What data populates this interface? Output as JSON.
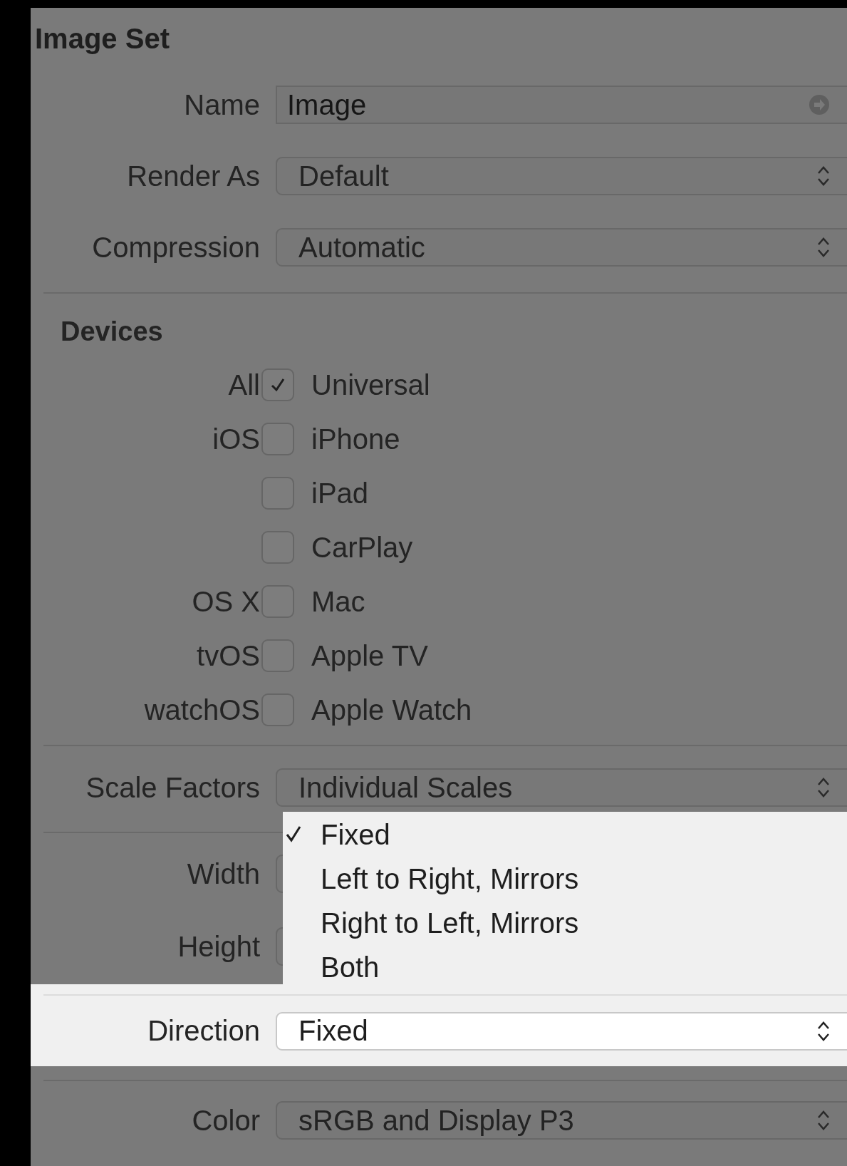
{
  "panel": {
    "title": "Image Set"
  },
  "attributes": [
    {
      "label": "Name",
      "kind": "text",
      "value": "Image"
    },
    {
      "label": "Render As",
      "kind": "popup",
      "value": "Default"
    },
    {
      "label": "Compression",
      "kind": "popup",
      "value": "Automatic"
    }
  ],
  "devices": {
    "title": "Devices",
    "items": [
      {
        "group": "All",
        "label": "Universal",
        "checked": true
      },
      {
        "group": "iOS",
        "label": "iPhone",
        "checked": false
      },
      {
        "label": "iPad",
        "checked": false
      },
      {
        "label": "CarPlay",
        "checked": false
      },
      {
        "group": "OS X",
        "label": "Mac",
        "checked": false
      },
      {
        "group": "tvOS",
        "label": "Apple TV",
        "checked": false
      },
      {
        "group": "watchOS",
        "label": "Apple Watch",
        "checked": false
      }
    ]
  },
  "scale_factors": {
    "label": "Scale Factors",
    "value": "Individual Scales"
  },
  "size": [
    {
      "label": "Width"
    },
    {
      "label": "Height"
    }
  ],
  "direction": {
    "label": "Direction",
    "value": "Fixed"
  },
  "direction_menu": {
    "items": [
      {
        "label": "Fixed",
        "selected": true
      },
      {
        "label": "Left to Right, Mirrors",
        "selected": false
      },
      {
        "label": "Right to Left, Mirrors",
        "selected": false
      },
      {
        "label": "Both",
        "selected": false
      }
    ]
  },
  "color": {
    "label": "Color",
    "value": "sRGB and Display P3"
  }
}
